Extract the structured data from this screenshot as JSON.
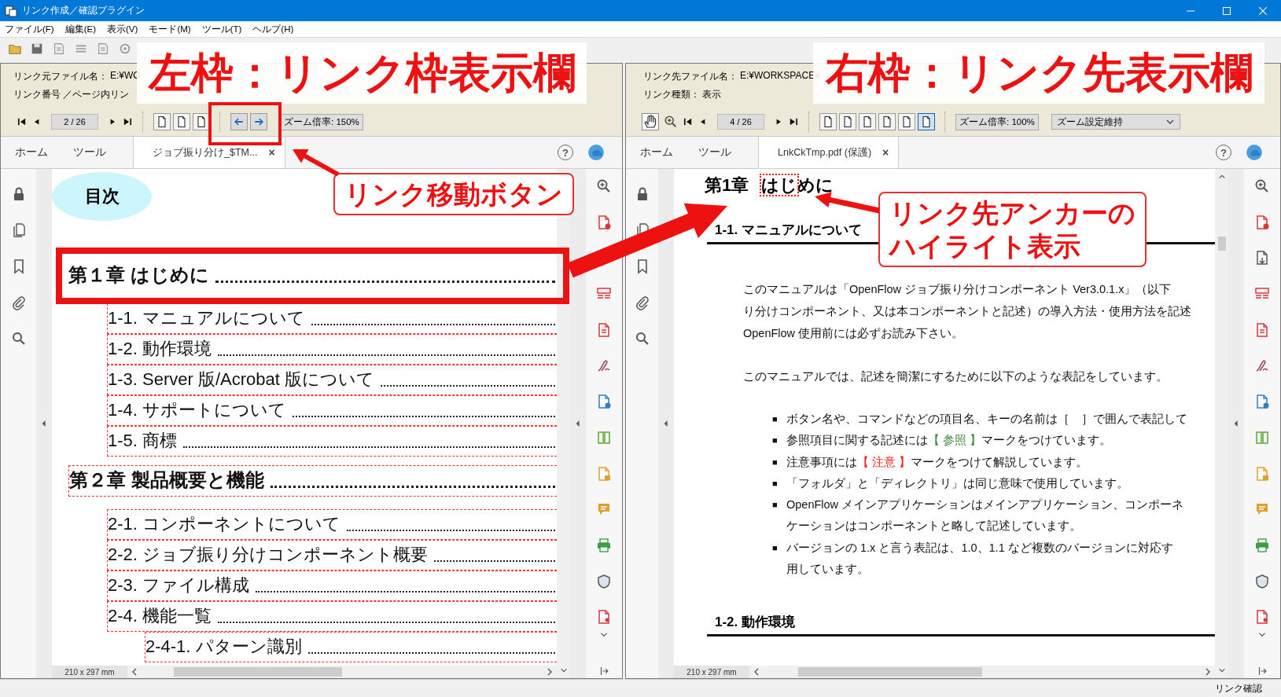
{
  "window": {
    "title": "リンク作成／確認プラグイン"
  },
  "menu": [
    "ファイル(F)",
    "編集(E)",
    "表示(V)",
    "モード(M)",
    "ツール(T)",
    "ヘルプ(H)"
  ],
  "panes": [
    {
      "kind": "source",
      "info": [
        {
          "label": "リンク元ファイル名：",
          "value": "E:¥WO"
        },
        {
          "label": "リンク番号 ／ページ内リン"
        }
      ],
      "page": "2 / 26",
      "view_buttons": [
        {
          "selected": false
        },
        {
          "selected": false
        },
        {
          "selected": false
        }
      ],
      "zoom": "ズーム倍率: 150%",
      "tabs": [
        {
          "label": "ホーム",
          "selected": false
        },
        {
          "label": "ツール",
          "selected": false
        },
        {
          "label": "ジョブ振り分け_$TM...",
          "selected": true,
          "close": "×"
        }
      ],
      "help": "?",
      "page_size": "210 x 297 mm",
      "document": {
        "kind": "toc",
        "heading": "目次",
        "entries": [
          {
            "text": "第１章  はじめに",
            "highlighted": true,
            "children": [
              {
                "text": "1-1.  マニュアルについて"
              },
              {
                "text": "1-2.  動作環境"
              },
              {
                "text": "1-3.  Server 版/Acrobat 版について"
              },
              {
                "text": "1-4.  サポートについて"
              },
              {
                "text": "1-5.  商標"
              }
            ]
          },
          {
            "text": "第２章  製品概要と機能",
            "highlighted": false,
            "children": [
              {
                "text": "2-1.  コンポーネントについて"
              },
              {
                "text": "2-2.  ジョブ振り分けコンポーネント概要"
              },
              {
                "text": "2-3.  ファイル構成"
              },
              {
                "text": "2-4.  機能一覧",
                "children": [
                  {
                    "text": "2-4-1. パターン識別"
                  }
                ]
              }
            ]
          }
        ]
      }
    },
    {
      "kind": "target",
      "info": [
        {
          "label": "リンク先ファイル名：",
          "value": "E:¥WORKSPACE¥"
        },
        {
          "label": "リンク種類：",
          "value": "表示"
        }
      ],
      "page": "4 / 26",
      "view_buttons": [
        {
          "selected": false
        },
        {
          "selected": false
        },
        {
          "selected": false
        },
        {
          "selected": false
        },
        {
          "selected": false
        },
        {
          "selected": true
        }
      ],
      "zoom": "ズーム倍率: 100%",
      "zoom_setting": "ズーム設定維持",
      "tabs": [
        {
          "label": "ホーム",
          "selected": false
        },
        {
          "label": "ツール",
          "selected": false
        },
        {
          "label": "LnkCkTmp.pdf (保護)",
          "selected": true,
          "close": "×"
        }
      ],
      "help": "?",
      "page_size": "210 x 297 mm",
      "document": {
        "kind": "page",
        "blocks": [
          {
            "kind": "chapter",
            "before": "第1章",
            "anchor": "はじ",
            "after": "めに"
          },
          {
            "kind": "section",
            "text": "1-1.   マニュアルについて"
          },
          {
            "kind": "para",
            "lines": [
              "このマニュアルは「OpenFlow ジョブ振り分けコンポーネント Ver3.0.1.x」（以下",
              "り分けコンポーネント、又は本コンポーネントと記述）の導入方法・使用方法を記述",
              "OpenFlow 使用前には必ずお読み下さい。"
            ]
          },
          {
            "kind": "para",
            "lines": [
              "このマニュアルでは、記述を簡潔にするために以下のような表記をしています。"
            ]
          },
          {
            "kind": "bullet",
            "mark": "■",
            "lines": [
              [
                {
                  "text": "ボタン名や、コマンドなどの項目名、キーの名前は［　］で囲んで表記して"
                }
              ]
            ]
          },
          {
            "kind": "bullet",
            "mark": "■",
            "lines": [
              [
                {
                  "text": "参照項目に関する記述には"
                },
                {
                  "text": "【 参照 】",
                  "color": "#3a8a3a"
                },
                {
                  "text": "マークをつけています。"
                }
              ]
            ]
          },
          {
            "kind": "bullet",
            "mark": "■",
            "lines": [
              [
                {
                  "text": "注意事項には"
                },
                {
                  "text": "【 注意 】",
                  "color": "#e8231e"
                },
                {
                  "text": "マークをつけて解説しています。"
                }
              ]
            ]
          },
          {
            "kind": "bullet",
            "mark": "■",
            "lines": [
              [
                {
                  "text": "「フォルダ」と「ディレクトリ」は同じ意味で使用しています。"
                }
              ]
            ]
          },
          {
            "kind": "bullet",
            "mark": "■",
            "lines": [
              [
                {
                  "text": "OpenFlow メインアプリケーションはメインアプリケーション、コンポーネ"
                }
              ],
              [
                {
                  "text": "ケーションはコンポーネントと略して記述しています。"
                }
              ]
            ]
          },
          {
            "kind": "bullet",
            "mark": "■",
            "lines": [
              [
                {
                  "text": "バージョンの 1.x と言う表記は、1.0、1.1 など複数のバージョンに対応す"
                }
              ],
              [
                {
                  "text": "用しています。"
                }
              ]
            ]
          },
          {
            "kind": "section",
            "text": "1-2.   動作環境"
          }
        ]
      }
    }
  ],
  "status_bar": "リンク確認",
  "annotations": [
    {
      "kind": "title",
      "text": "左枠：リンク枠表示欄"
    },
    {
      "kind": "title",
      "text": "右枠：リンク先表示欄"
    },
    {
      "kind": "frame"
    },
    {
      "kind": "arrow"
    },
    {
      "kind": "callout",
      "lines": [
        "リンク移動ボタン"
      ]
    },
    {
      "kind": "arrow"
    },
    {
      "kind": "callout",
      "lines": [
        "リンク先アンカーの",
        "ハイライト表示"
      ]
    },
    {
      "kind": "arrow"
    }
  ]
}
